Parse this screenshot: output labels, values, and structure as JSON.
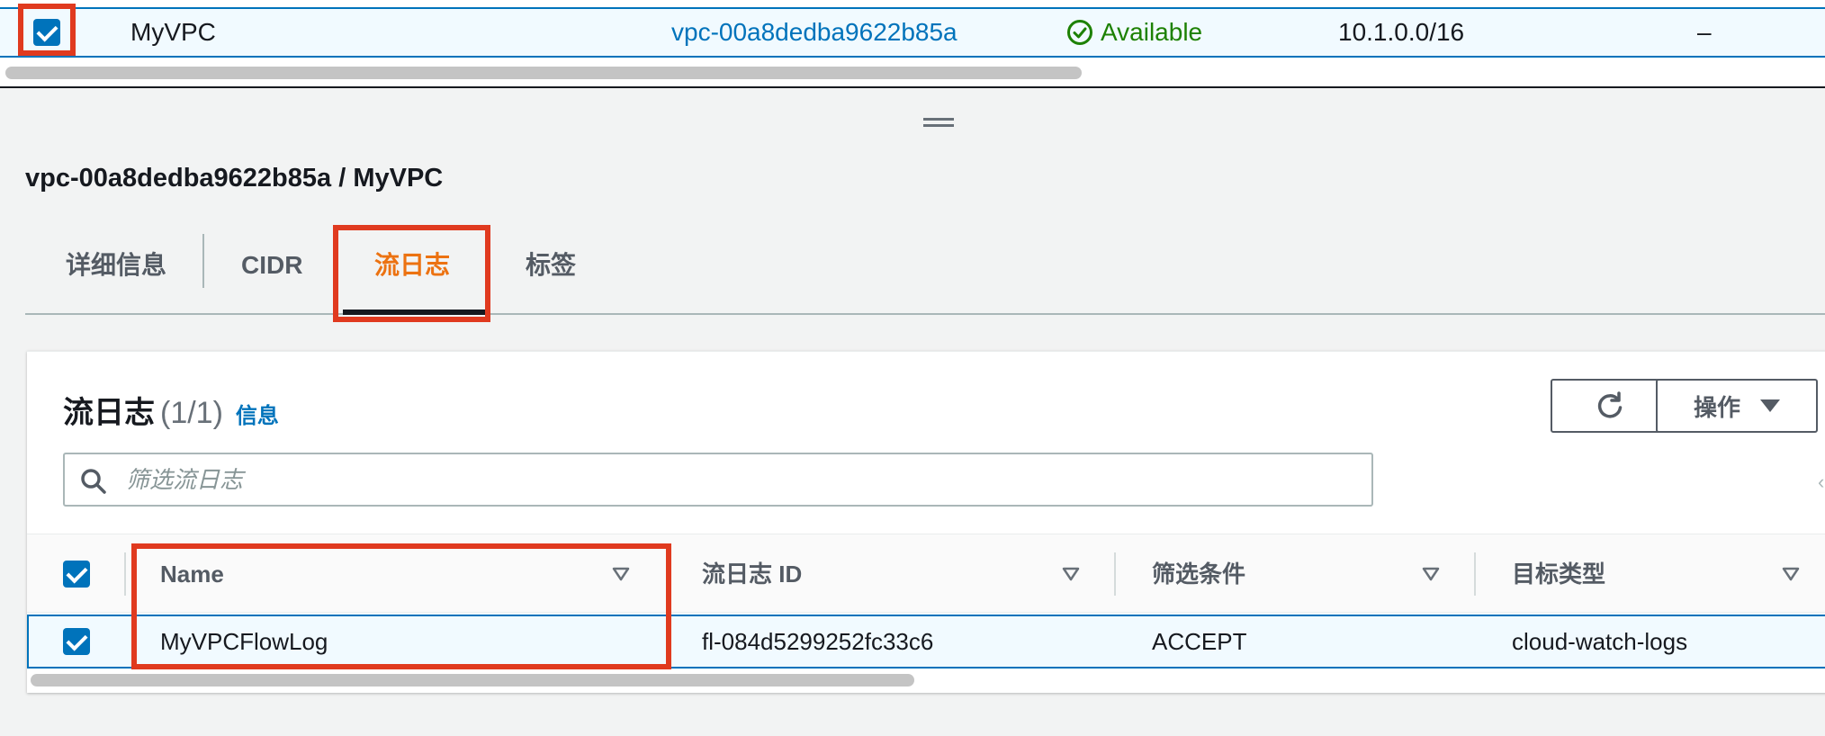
{
  "vpc_row": {
    "name": "MyVPC",
    "vpc_id": "vpc-00a8dedba9622b85a",
    "state": "Available",
    "ipv4_cidr": "10.1.0.0/16",
    "ipv6_cidr": "–",
    "selected": true
  },
  "detail_panel": {
    "title": "vpc-00a8dedba9622b85a / MyVPC",
    "tabs": [
      {
        "label": "详细信息",
        "active": false
      },
      {
        "label": "CIDR",
        "active": false
      },
      {
        "label": "流日志",
        "active": true
      },
      {
        "label": "标签",
        "active": false
      }
    ]
  },
  "flow_logs": {
    "title": "流日志",
    "count": "(1/1)",
    "info_link": "信息",
    "actions_label": "操作",
    "search_placeholder": "筛选流日志",
    "search_value": "",
    "columns": [
      "Name",
      "流日志 ID",
      "筛选条件",
      "目标类型"
    ],
    "rows": [
      {
        "name": "MyVPCFlowLog",
        "id": "fl-084d5299252fc33c6",
        "filter": "ACCEPT",
        "destination_type": "cloud-watch-logs",
        "selected": true
      }
    ]
  },
  "colors": {
    "accent_blue": "#0073bb",
    "active_tab_orange": "#ec7211",
    "status_green": "#1d8102",
    "highlight_red": "#e03a1f"
  },
  "icons": [
    "checkbox-checked-icon",
    "status-available-icon",
    "refresh-icon",
    "caret-down-icon",
    "search-icon",
    "sort-icon",
    "drag-handle-icon"
  ]
}
